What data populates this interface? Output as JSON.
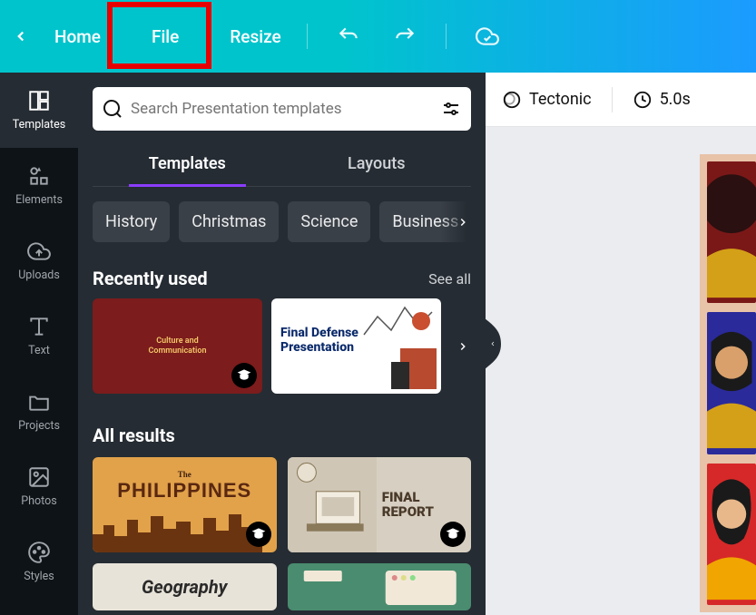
{
  "topbar": {
    "home": "Home",
    "file": "File",
    "resize": "Resize"
  },
  "rail": {
    "templates": "Templates",
    "elements": "Elements",
    "uploads": "Uploads",
    "text": "Text",
    "projects": "Projects",
    "photos": "Photos",
    "styles": "Styles"
  },
  "panel": {
    "search_placeholder": "Search Presentation templates",
    "tab_templates": "Templates",
    "tab_layouts": "Layouts",
    "chips": [
      "History",
      "Christmas",
      "Science",
      "Business"
    ],
    "recently_used": "Recently used",
    "see_all": "See all",
    "recent": [
      {
        "title_line1": "Culture and",
        "title_line2": "Communication"
      },
      {
        "title_line1": "Final Defense",
        "title_line2": "Presentation"
      }
    ],
    "all_results": "All results",
    "grid": [
      {
        "pre": "The",
        "main": "PHILIPPINES"
      },
      {
        "line1": "FINAL",
        "line2": "REPORT"
      },
      {
        "label": "Geography"
      },
      {
        "label": ""
      }
    ]
  },
  "canvas": {
    "animation": "Tectonic",
    "duration": "5.0s"
  },
  "colors": {
    "accent_purple": "#8b3dff",
    "highlight_red": "#e60000",
    "teal": "#00c4cc",
    "blue": "#1b9bff",
    "dark_rail": "#0e1318",
    "dark_panel": "#252c33"
  }
}
